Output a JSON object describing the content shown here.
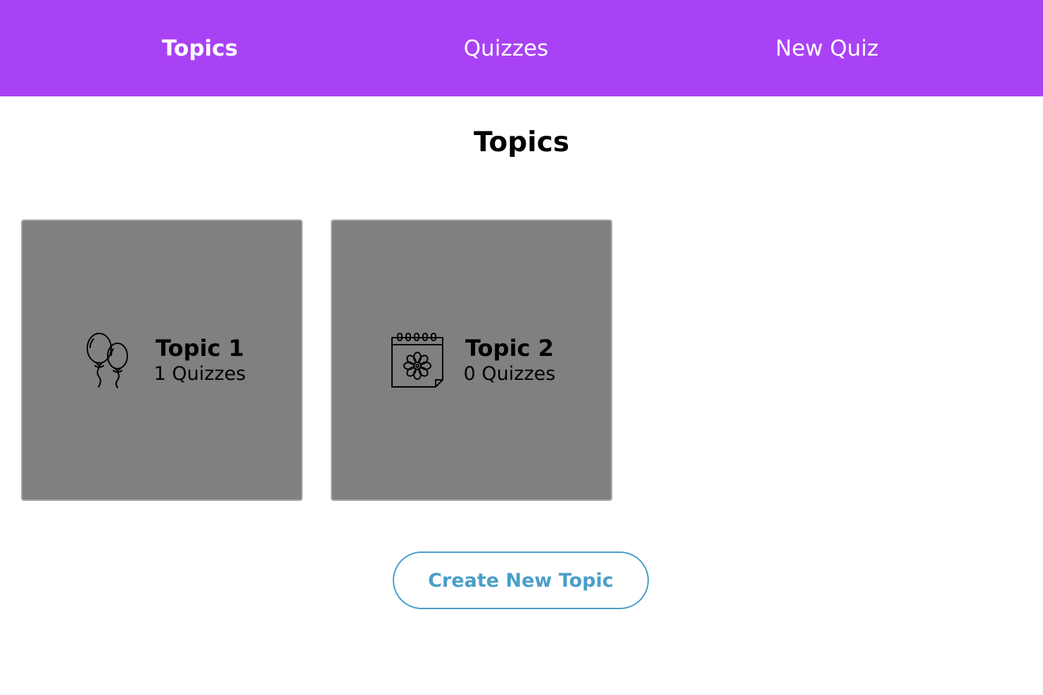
{
  "nav": {
    "items": [
      {
        "label": "Topics",
        "active": true
      },
      {
        "label": "Quizzes",
        "active": false
      },
      {
        "label": "New Quiz",
        "active": false
      }
    ]
  },
  "page": {
    "title": "Topics"
  },
  "topics": [
    {
      "name": "Topic 1",
      "count": "1 Quizzes",
      "icon": "balloons-icon"
    },
    {
      "name": "Topic 2",
      "count": "0 Quizzes",
      "icon": "calendar-flower-icon"
    }
  ],
  "actions": {
    "create_label": "Create New Topic"
  },
  "colors": {
    "navbar": "#a942f5",
    "card": "#808080",
    "button_accent": "#4a9fc8"
  }
}
